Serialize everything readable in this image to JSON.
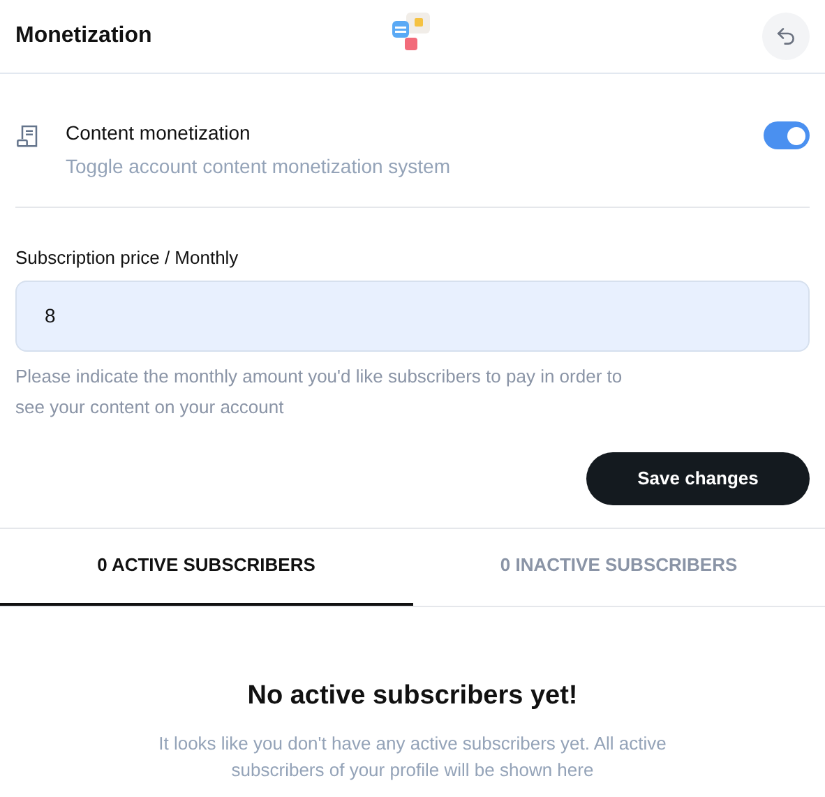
{
  "header": {
    "title": "Monetization"
  },
  "setting": {
    "title": "Content monetization",
    "description": "Toggle account content monetization system",
    "on": true
  },
  "price": {
    "label": "Subscription price / Monthly",
    "value": "8",
    "hint": "Please indicate the monthly amount you'd like subscribers to pay in order to see your content on your account"
  },
  "save_button": "Save changes",
  "tabs": [
    {
      "label": "0 ACTIVE SUBSCRIBERS",
      "selected": true
    },
    {
      "label": "0 INACTIVE SUBSCRIBERS",
      "selected": false
    }
  ],
  "empty_state": {
    "title": "No active subscribers yet!",
    "text": "It looks like you don't have any active subscribers yet. All active subscribers of your profile will be shown here"
  }
}
